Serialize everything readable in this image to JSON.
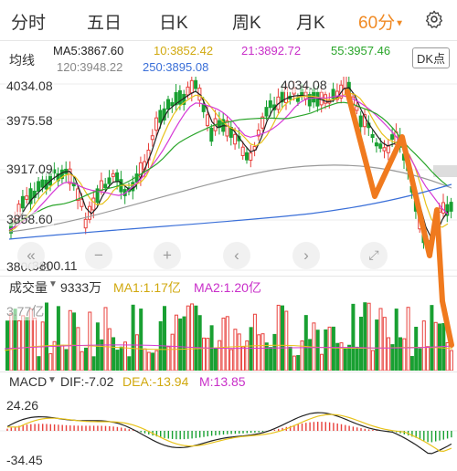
{
  "tabs": [
    {
      "label": "分时",
      "active": false
    },
    {
      "label": "五日",
      "active": false
    },
    {
      "label": "日K",
      "active": false
    },
    {
      "label": "周K",
      "active": false
    },
    {
      "label": "月K",
      "active": false
    },
    {
      "label": "60分",
      "active": true
    }
  ],
  "ma": {
    "type_label": "均线",
    "ma5": "MA5:3867.60",
    "ma10": "10:3852.42",
    "ma21": "21:3892.72",
    "ma55": "55:3957.46",
    "ma120": "120:3948.22",
    "ma250": "250:3895.08"
  },
  "dk_label": "DK点",
  "price_axis": {
    "top": "4034.08",
    "second": "3975.58",
    "third": "3917.09",
    "fourth": "3858.60",
    "bottom": "3800.11"
  },
  "high_marker": "4034.08",
  "low_marker": "3800.11",
  "volume": {
    "label": "成交量",
    "value": "9333万",
    "ma1": "MA1:1.17亿",
    "ma2": "MA2:1.20亿",
    "axis_top": "3.77亿"
  },
  "macd": {
    "label": "MACD",
    "dif": "DIF:-7.02",
    "dea": "DEA:-13.94",
    "m": "M:13.85",
    "axis_top": "24.26",
    "axis_bottom": "-34.45"
  },
  "colors": {
    "up": "#e8413c",
    "down": "#19a032",
    "accent": "#f08a24",
    "ma5": "#222222",
    "ma10": "#e8c31c",
    "ma21": "#d63ad6",
    "ma55": "#2aa52a",
    "ma120": "#999999",
    "ma250": "#3a6fd8"
  },
  "icons": [
    "gear-icon",
    "dropdown-caret-icon",
    "rewind-icon",
    "zoom-out-icon",
    "zoom-in-icon",
    "scroll-left-icon",
    "scroll-right-icon",
    "fullscreen-icon"
  ]
}
